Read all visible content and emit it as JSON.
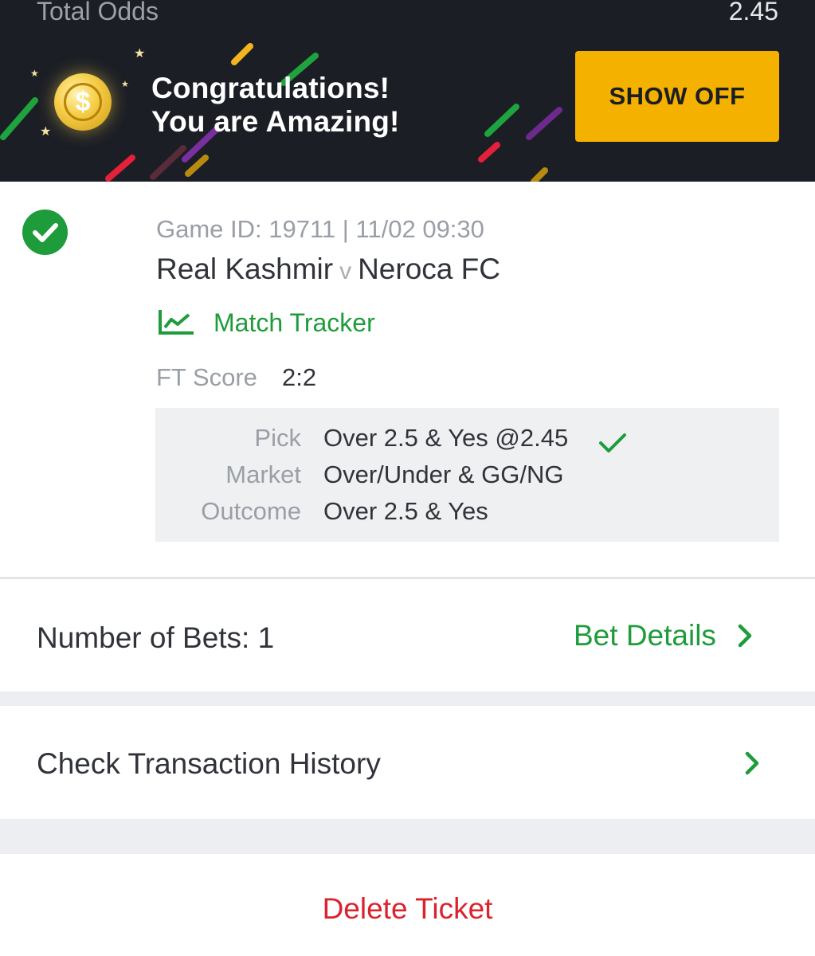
{
  "summary": {
    "total_odds_label": "Total Odds",
    "total_odds_value": "2.45"
  },
  "banner": {
    "line1": "Congratulations!",
    "line2": "You are Amazing!",
    "button_label": "SHOW OFF",
    "accent": "#f5b100"
  },
  "match": {
    "game_id": "Game ID: 19711 | 11/02 09:30",
    "home_team": "Real Kashmir",
    "vs": "v",
    "away_team": "Neroca FC",
    "tracker_label": "Match Tracker",
    "ft_label": "FT Score",
    "ft_value": "2:2"
  },
  "selection": {
    "pick_label": "Pick",
    "pick_value": "Over 2.5 & Yes @2.45",
    "market_label": "Market",
    "market_value": "Over/Under & GG/NG",
    "outcome_label": "Outcome",
    "outcome_value": "Over 2.5 & Yes"
  },
  "bets": {
    "count_label": "Number of Bets: 1",
    "details_label": "Bet Details"
  },
  "history": {
    "label": "Check Transaction History"
  },
  "delete": {
    "label": "Delete Ticket"
  },
  "colors": {
    "green": "#1e9c3b",
    "red": "#d9232d",
    "banner_bg": "#1b1e25"
  }
}
